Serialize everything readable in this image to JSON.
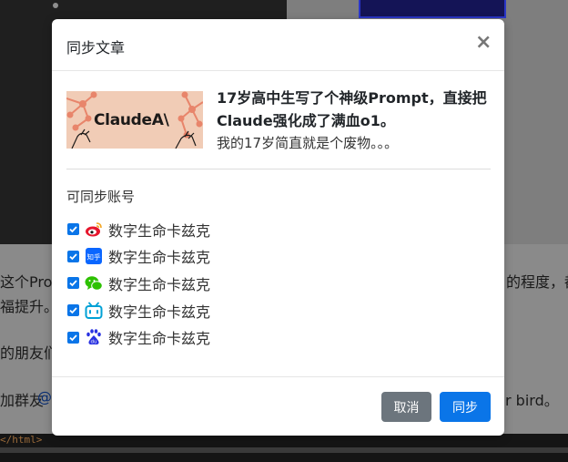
{
  "modal": {
    "title": "同步文章",
    "close_symbol": "×",
    "article": {
      "title": "17岁高中生写了个神级Prompt，直接把Claude强化成了满血o1。",
      "description": "我的17岁简直就是个废物。。。",
      "thumbnail_text": "ClaudeA\\"
    },
    "section_label": "可同步账号",
    "accounts": [
      {
        "platform": "weibo-icon",
        "name": "数字生命卡兹克",
        "checked": true,
        "color": "#e6162d"
      },
      {
        "platform": "zhihu-icon",
        "name": "数字生命卡兹克",
        "checked": true,
        "color": "#0a66ff",
        "icon_text": "知乎"
      },
      {
        "platform": "wechat-icon",
        "name": "数字生命卡兹克",
        "checked": true,
        "color": "#2dc100"
      },
      {
        "platform": "bilibili-icon",
        "name": "数字生命卡兹克",
        "checked": true,
        "color": "#00a1d6"
      },
      {
        "platform": "baidu-icon",
        "name": "数字生命卡兹克",
        "checked": true,
        "color": "#2932e1",
        "icon_text": "du"
      }
    ],
    "buttons": {
      "cancel": "取消",
      "sync": "同步"
    }
  },
  "background": {
    "line1_left": "这个Prom",
    "line1_right": "的程度，都",
    "line2": "福提升。",
    "line3": "的朋友们",
    "line4_left": "加群友",
    "line4_link": "@",
    "line4_right": "r bird。",
    "code_snippet": "</html>"
  },
  "colors": {
    "primary": "#0a75e8",
    "secondary": "#6c757d",
    "thumbnail_bg": "#f1ccb6",
    "thumbnail_accent": "#e8856b"
  }
}
